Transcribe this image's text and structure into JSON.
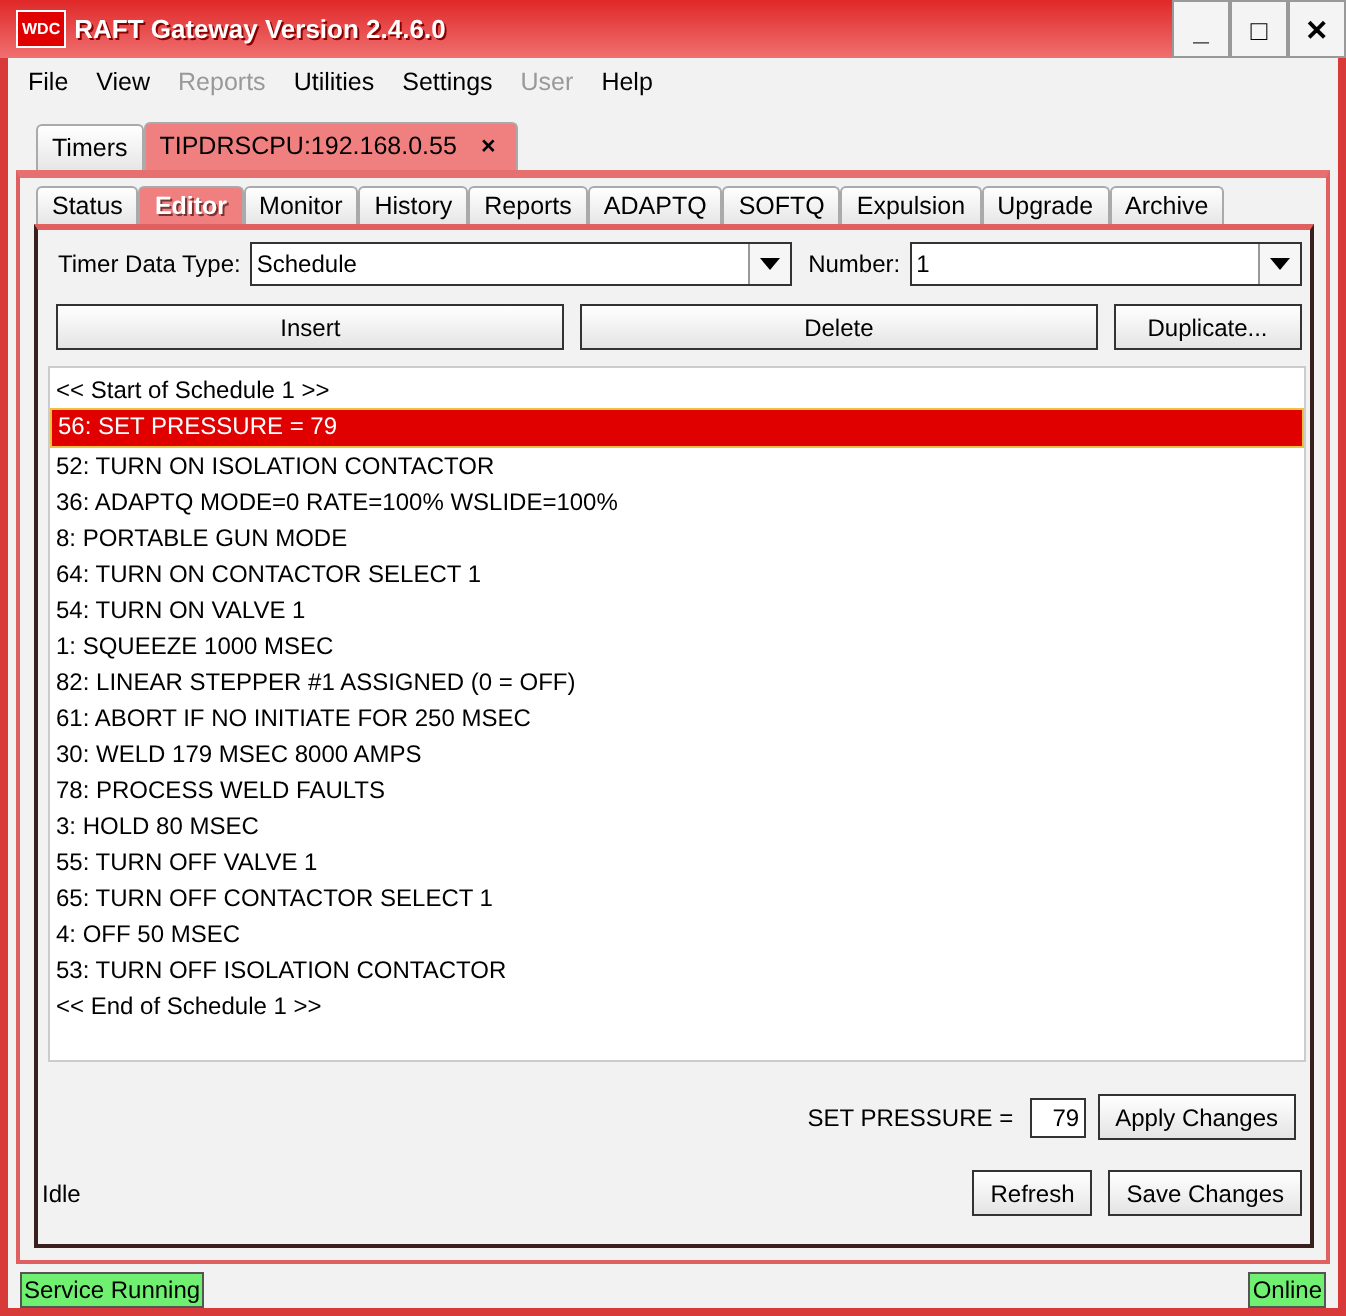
{
  "window": {
    "logo": "WDC",
    "title": "RAFT Gateway Version 2.4.6.0",
    "controls": [
      "_",
      "□",
      "✕"
    ]
  },
  "menu": [
    {
      "label": "File",
      "disabled": false
    },
    {
      "label": "View",
      "disabled": false
    },
    {
      "label": "Reports",
      "disabled": true
    },
    {
      "label": "Utilities",
      "disabled": false
    },
    {
      "label": "Settings",
      "disabled": false
    },
    {
      "label": "User",
      "disabled": true
    },
    {
      "label": "Help",
      "disabled": false
    }
  ],
  "top_tabs": [
    {
      "label": "Timers",
      "selected": false
    },
    {
      "label": "TIPDRSCPU:192.168.0.55",
      "selected": true,
      "close": "×"
    }
  ],
  "tabs": [
    {
      "label": "Status",
      "selected": false
    },
    {
      "label": "Editor",
      "selected": true
    },
    {
      "label": "Monitor",
      "selected": false
    },
    {
      "label": "History",
      "selected": false
    },
    {
      "label": "Reports",
      "selected": false
    },
    {
      "label": "ADAPTQ",
      "selected": false
    },
    {
      "label": "SOFTQ",
      "selected": false
    },
    {
      "label": "Expulsion",
      "selected": false
    },
    {
      "label": "Upgrade",
      "selected": false
    },
    {
      "label": "Archive",
      "selected": false
    }
  ],
  "timer_data_type": {
    "label": "Timer Data Type:",
    "value": "Schedule"
  },
  "number": {
    "label": "Number:",
    "value": "1"
  },
  "actions": [
    "Insert",
    "Delete",
    "Duplicate..."
  ],
  "schedule": [
    {
      "text": "<< Start of Schedule 1 >>",
      "selected": false
    },
    {
      "text": "56: SET PRESSURE = 79",
      "selected": true
    },
    {
      "text": "52: TURN ON ISOLATION CONTACTOR",
      "selected": false
    },
    {
      "text": "36: ADAPTQ MODE=0 RATE=100% WSLIDE=100%",
      "selected": false
    },
    {
      "text": "8: PORTABLE GUN MODE",
      "selected": false
    },
    {
      "text": "64: TURN ON CONTACTOR SELECT 1",
      "selected": false
    },
    {
      "text": "54: TURN ON VALVE 1",
      "selected": false
    },
    {
      "text": "1: SQUEEZE 1000 MSEC",
      "selected": false
    },
    {
      "text": "82: LINEAR STEPPER #1 ASSIGNED (0 = OFF)",
      "selected": false
    },
    {
      "text": "61: ABORT IF NO INITIATE FOR 250 MSEC",
      "selected": false
    },
    {
      "text": "30: WELD 179 MSEC 8000 AMPS",
      "selected": false
    },
    {
      "text": "78: PROCESS WELD FAULTS",
      "selected": false
    },
    {
      "text": "3: HOLD 80 MSEC",
      "selected": false
    },
    {
      "text": "55: TURN OFF VALVE 1",
      "selected": false
    },
    {
      "text": "65: TURN OFF CONTACTOR SELECT 1",
      "selected": false
    },
    {
      "text": "4: OFF 50 MSEC",
      "selected": false
    },
    {
      "text": "53: TURN OFF ISOLATION CONTACTOR",
      "selected": false
    },
    {
      "text": "<< End of Schedule 1 >>",
      "selected": false
    }
  ],
  "parameter": {
    "label": "SET PRESSURE =",
    "value": "79",
    "button": "Apply Changes"
  },
  "status": "Idle",
  "footer_buttons": [
    "Refresh",
    "Save Changes"
  ],
  "status_bar": {
    "service": "Service Running",
    "connection": "Online"
  }
}
